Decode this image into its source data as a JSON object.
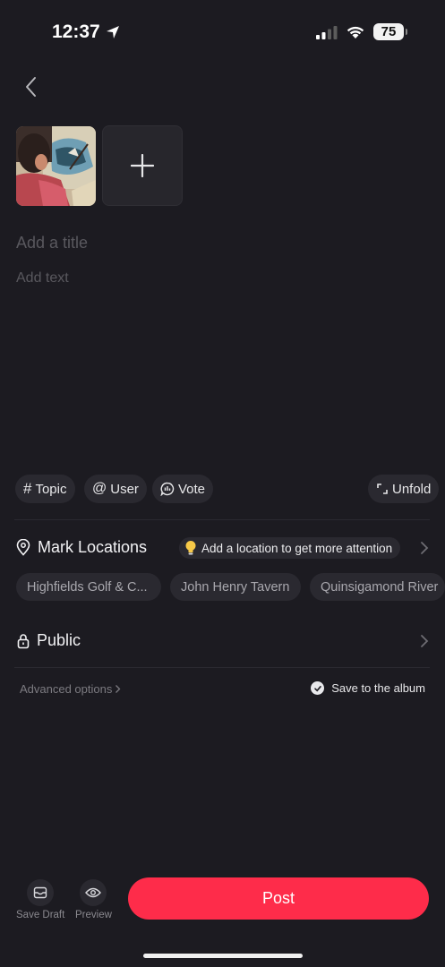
{
  "status_bar": {
    "time": "12:37",
    "battery": "75"
  },
  "editor": {
    "title_placeholder": "Add a title",
    "text_placeholder": "Add text"
  },
  "chips": {
    "topic": "Topic",
    "user": "User",
    "vote": "Vote",
    "unfold": "Unfold"
  },
  "location": {
    "label": "Mark Locations",
    "tip": "Add a location to get more attention",
    "suggestions": [
      "Highfields Golf & C...",
      "John Henry Tavern",
      "Quinsigamond River"
    ]
  },
  "visibility": {
    "label": "Public"
  },
  "options": {
    "advanced": "Advanced options",
    "save_album": "Save to the album"
  },
  "bottom": {
    "save_draft": "Save Draft",
    "preview": "Preview",
    "post": "Post"
  },
  "colors": {
    "background": "#1c1b21",
    "accent": "#fe2c4a",
    "chip": "#2a2930"
  }
}
